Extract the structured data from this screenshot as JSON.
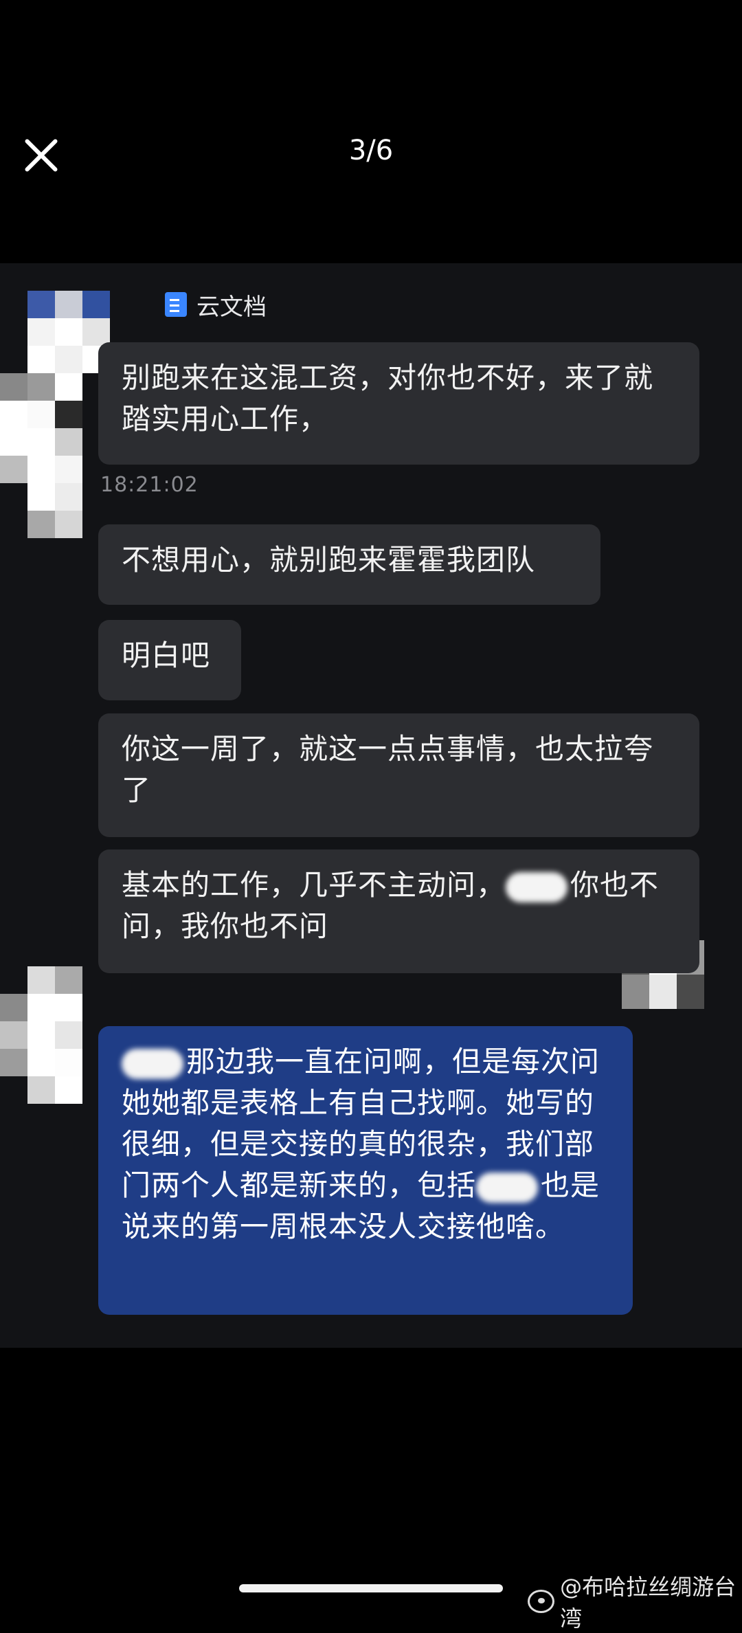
{
  "viewer": {
    "page_counter": "3/6"
  },
  "chat": {
    "doc_label": "云文档",
    "timestamp": "18:21:02",
    "messages": [
      {
        "text": "别跑来在这混工资，对你也不好，来了就踏实用心工作，"
      },
      {
        "text": "不想用心，就别跑来霍霍我团队"
      },
      {
        "text": "明白吧"
      },
      {
        "text": "你这一周了，就这一点点事情，也太拉夸了"
      },
      {
        "text_before": "基本的工作，几乎不主动问，",
        "text_after": "你也不问，我你也不问"
      },
      {
        "text_a": "那边我一直在问啊，但是每次问她她都是表格上有自己找啊。她写的很细，但是交接的真的很杂，我们部门两个人都是新来的，包括",
        "text_b": "也是说来的第一周根本没人交接他啥。"
      }
    ]
  },
  "watermark": {
    "text": "@布哈拉丝绸游台湾"
  },
  "colors": {
    "incoming_bubble": "#2c2d31",
    "outgoing_bubble": "#1f3d86",
    "background": "#000000"
  }
}
